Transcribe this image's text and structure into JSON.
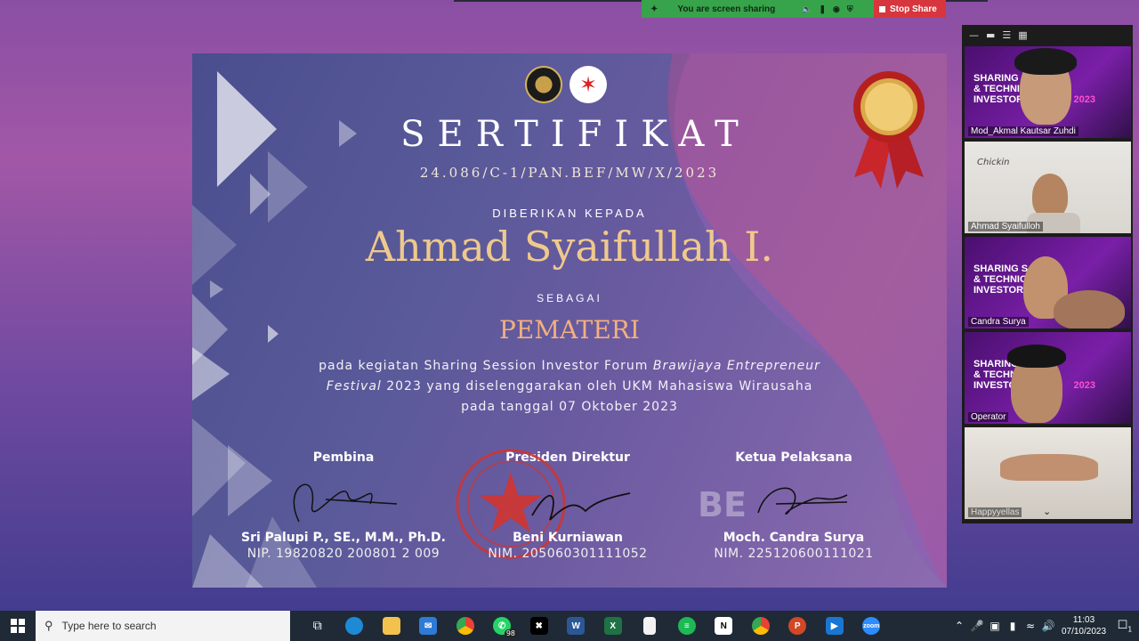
{
  "share_bar": {
    "status": "You are screen sharing",
    "stop_label": "Stop Share"
  },
  "certificate": {
    "title": "SERTIFIKAT",
    "number": "24.086/C-1/PAN.BEF/MW/X/2023",
    "given_to": "DIBERIKAN KEPADA",
    "name": "Ahmad Syaifullah I.",
    "as_label": "SEBAGAI",
    "role": "PEMATERI",
    "desc_line1_a": "pada kegiatan Sharing Session Investor Forum ",
    "desc_line1_b": "Brawijaya Entrepreneur",
    "desc_line2_a": "Festival",
    "desc_line2_b": " 2023 yang diselenggarakan oleh UKM Mahasiswa Wirausaha",
    "desc_line3": "pada tanggal 07 Oktober 2023",
    "signatories": [
      {
        "role": "Pembina",
        "name": "Sri Palupi P., SE., M.M., Ph.D.",
        "id": "NIP. 19820820 200801 2 009"
      },
      {
        "role": "Presiden Direktur",
        "name": "Beni Kurniawan",
        "id": "NIM. 205060301111052"
      },
      {
        "role": "Ketua Pelaksana",
        "name": "Moch. Candra Surya",
        "id": "NIM. 225120600111021"
      }
    ]
  },
  "participants": [
    {
      "name": "Mod_Akmal Kautsar Zuhdi"
    },
    {
      "name": "Ahmad Syaifulloh"
    },
    {
      "name": "Candra Surya"
    },
    {
      "name": "Operator"
    },
    {
      "name": "Happyyellas"
    }
  ],
  "tile_text": {
    "banner1": "SHARING S",
    "banner2": "& TECHNIC",
    "banner3": "INVESTOR F",
    "year": "2023",
    "chicken": "Chickin"
  },
  "taskbar": {
    "search_placeholder": "Type here to search",
    "whatsapp_badge": "98",
    "time": "11:03",
    "date": "07/10/2023",
    "notif_count": "1"
  },
  "colors": {
    "share_green": "#37a34a",
    "stop_red": "#d7363e",
    "name_gold": "#efc98c",
    "role_orange": "#f2b07e"
  }
}
